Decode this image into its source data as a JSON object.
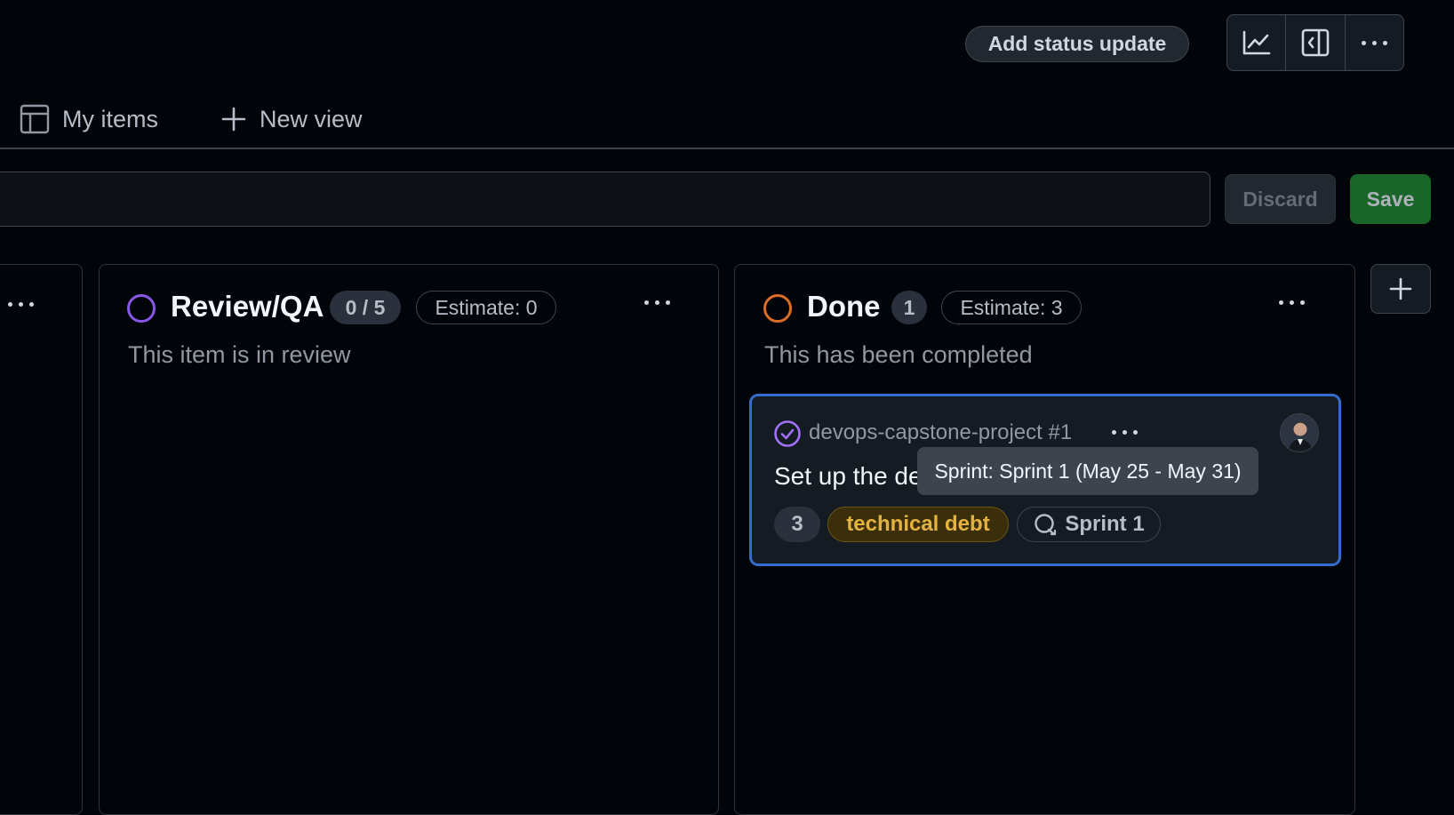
{
  "header": {
    "status_update_label": "Add status update",
    "icons": [
      "insights-icon",
      "sidebar-toggle-icon",
      "kebab-horizontal-icon"
    ]
  },
  "views": {
    "tabs": [
      {
        "label": "My items",
        "icon": "table-icon"
      },
      {
        "label": "New view",
        "icon": "plus-icon"
      }
    ]
  },
  "filter": {
    "value": "",
    "discard_label": "Discard",
    "save_label": "Save"
  },
  "columns": [
    {
      "title": "Review/QA",
      "count": "0 / 5",
      "estimate": "Estimate: 0",
      "description": "This item is in review",
      "status_color": "#8957e5",
      "cards": []
    },
    {
      "title": "Done",
      "count": "1",
      "estimate": "Estimate: 3",
      "description": "This has been completed",
      "status_color": "#db6d28",
      "cards": [
        {
          "repo_ref": "devops-capstone-project #1",
          "title": "Set up the de",
          "state_icon": "issue-closed-icon",
          "state_color": "#a371f7",
          "estimate": "3",
          "label": "technical debt",
          "label_color": "#d4a72c",
          "iteration": "Sprint 1",
          "iteration_icon": "iterations-icon",
          "tooltip": "Sprint: Sprint 1 (May 25 - May 31)"
        }
      ]
    }
  ],
  "colors": {
    "background": "#010409",
    "accent_border": "#316dca",
    "save_green": "#238636"
  }
}
